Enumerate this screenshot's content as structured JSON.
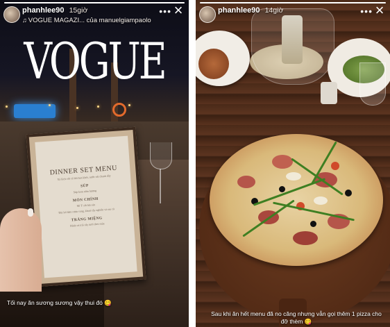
{
  "left_story": {
    "username": "phanhlee90",
    "time": "15giờ",
    "music": "VOGUE MAGAZI... của manuelgiampaolo",
    "music_icon": "music-note",
    "close_icon": "×",
    "more_icon": "•••",
    "magazine_title": "VOGUE",
    "progress": 1.0,
    "menu": {
      "title": "DINNER SET MENU",
      "lines": [
        "Xà lách với cá hồi hun khói, nước sốt chanh dây",
        "SÚP",
        "Súp kem nấm hương",
        "MÓN CHÍNH",
        "Mì Ý sốt hải sản",
        "Thịt bò hầm rượu vang, khoai tây nghiền và rau củ",
        "TRÁNG MIỆNG",
        "Bánh và trái cây tươi theo mùa"
      ]
    },
    "caption": "Tối nay ăn sương sương vậy thui đó 😋"
  },
  "right_story": {
    "username": "phanhlee90",
    "time": "14giờ",
    "close_icon": "×",
    "more_icon": "•••",
    "progress": 1.0,
    "caption": "Sau khi ăn hết menu đã no căng nhưng vẫn gọi thêm 1 pizza cho đỡ thèm 😋"
  }
}
